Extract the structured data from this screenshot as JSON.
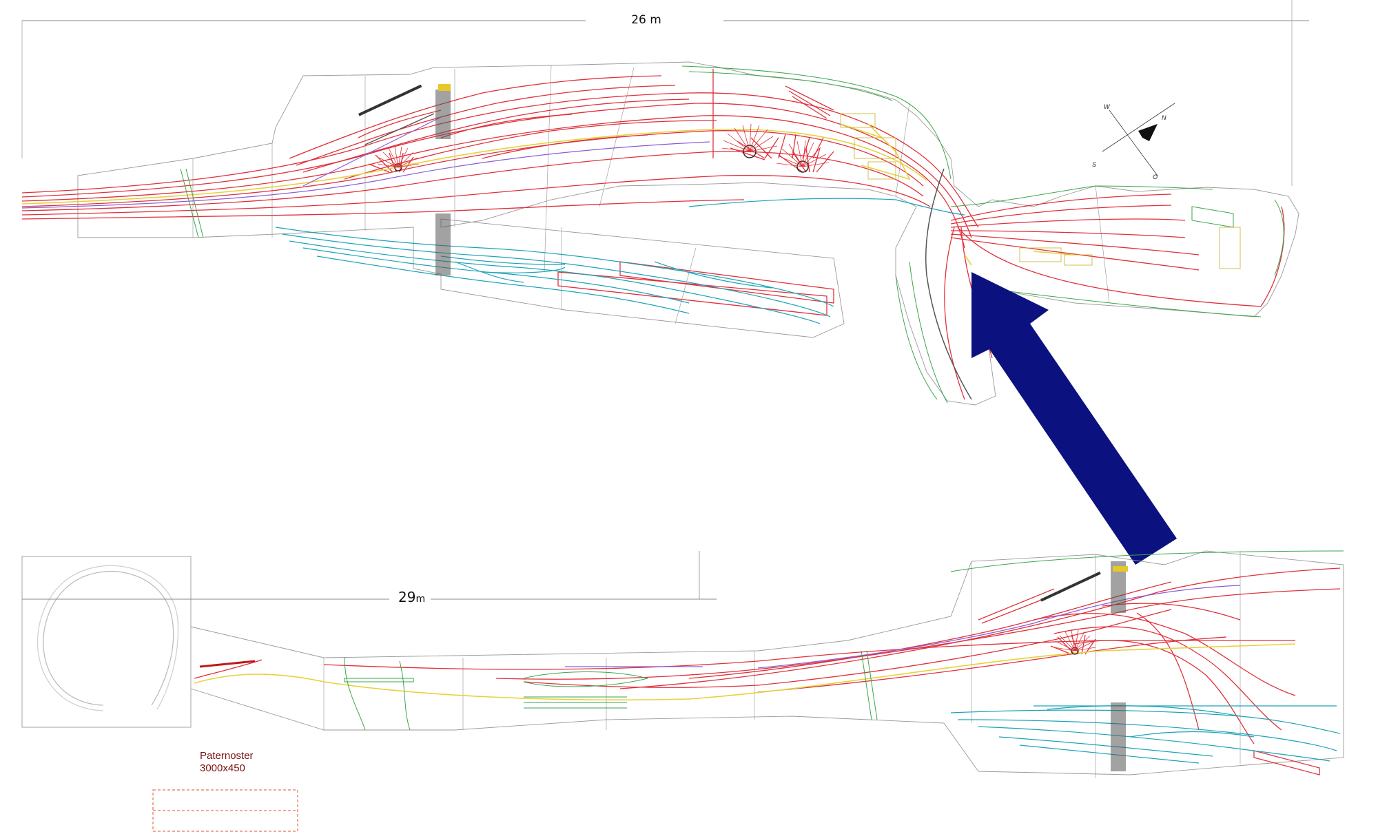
{
  "diagram": {
    "dimensions": {
      "upper_label": "26 m",
      "lower_label_number": "29",
      "lower_label_unit": "m"
    },
    "compass": {
      "north": "N",
      "west": "W",
      "south": "S",
      "east": "O"
    },
    "paternoster": {
      "title": "Paternoster",
      "size": "3000x450"
    },
    "colors": {
      "track_red": "#e0303a",
      "track_cyan": "#1aa3b8",
      "track_yellow": "#e6d23a",
      "track_green": "#3aa64a",
      "track_purple": "#8a5cd6",
      "outline_grey": "#8a8a8a",
      "arrow_blue": "#0b1280",
      "paternoster_red": "#e05030",
      "paternoster_text": "#7a1010"
    }
  }
}
